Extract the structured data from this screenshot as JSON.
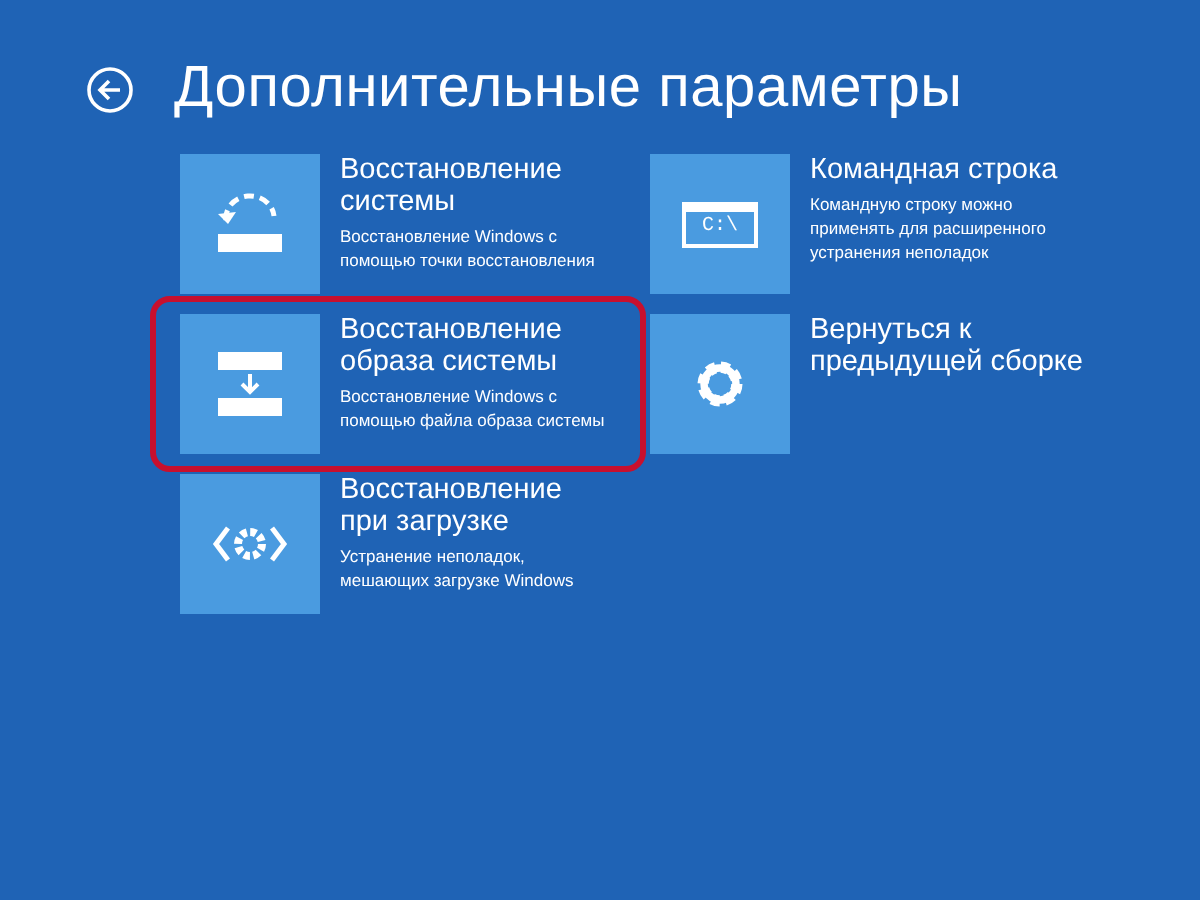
{
  "title": "Дополнительные параметры",
  "columns": [
    [
      {
        "kind": "restore",
        "title": "Восстановление системы",
        "description": "Восстановление Windows с помощью точки восстановления",
        "highlighted": false
      },
      {
        "kind": "image",
        "title": "Восстановление образа системы",
        "description": "Восстановление Windows с помощью файла образа системы",
        "highlighted": true
      },
      {
        "kind": "startup",
        "title": "Восстановление при загрузке",
        "description": "Устранение неполадок, мешающих загрузке Windows",
        "highlighted": false
      }
    ],
    [
      {
        "kind": "console",
        "icon_text": "C:\\",
        "title": "Командная строка",
        "description": "Командную строку можно применять для расширенного устранения неполадок",
        "highlighted": false
      },
      {
        "kind": "settings",
        "title": "Вернуться к предыдущей сборке",
        "highlighted": false
      }
    ]
  ]
}
